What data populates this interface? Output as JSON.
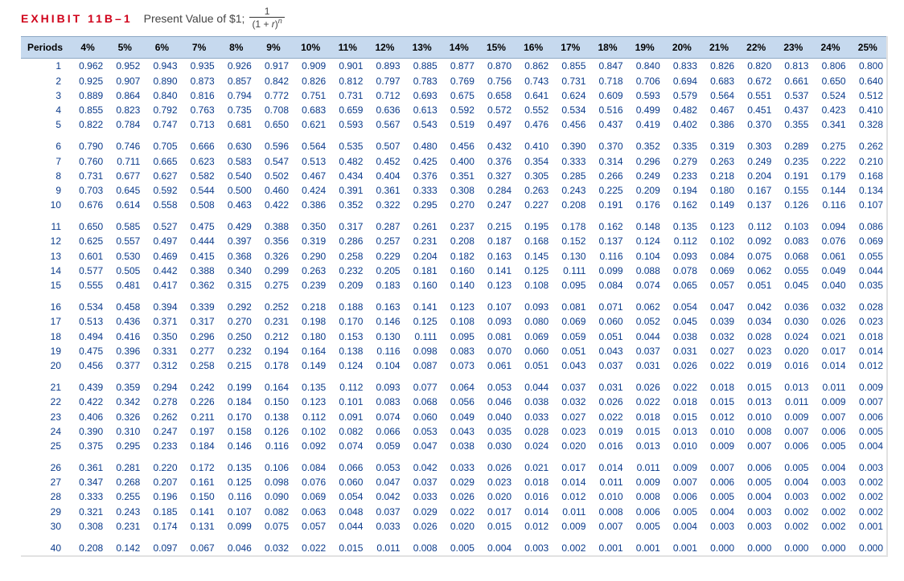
{
  "title": {
    "exhibit": "EXHIBIT 11B–1",
    "text": "Present Value of $1;",
    "frac_num": "1",
    "frac_den_l": "(1 + ",
    "frac_den_var": "r",
    "frac_den_r": ")",
    "frac_exp": "n"
  },
  "headers": [
    "Periods",
    "4%",
    "5%",
    "6%",
    "7%",
    "8%",
    "9%",
    "10%",
    "11%",
    "12%",
    "13%",
    "14%",
    "15%",
    "16%",
    "17%",
    "18%",
    "19%",
    "20%",
    "21%",
    "22%",
    "23%",
    "24%",
    "25%"
  ],
  "groups": [
    [
      {
        "p": 1,
        "v": [
          "0.962",
          "0.952",
          "0.943",
          "0.935",
          "0.926",
          "0.917",
          "0.909",
          "0.901",
          "0.893",
          "0.885",
          "0.877",
          "0.870",
          "0.862",
          "0.855",
          "0.847",
          "0.840",
          "0.833",
          "0.826",
          "0.820",
          "0.813",
          "0.806",
          "0.800"
        ]
      },
      {
        "p": 2,
        "v": [
          "0.925",
          "0.907",
          "0.890",
          "0.873",
          "0.857",
          "0.842",
          "0.826",
          "0.812",
          "0.797",
          "0.783",
          "0.769",
          "0.756",
          "0.743",
          "0.731",
          "0.718",
          "0.706",
          "0.694",
          "0.683",
          "0.672",
          "0.661",
          "0.650",
          "0.640"
        ]
      },
      {
        "p": 3,
        "v": [
          "0.889",
          "0.864",
          "0.840",
          "0.816",
          "0.794",
          "0.772",
          "0.751",
          "0.731",
          "0.712",
          "0.693",
          "0.675",
          "0.658",
          "0.641",
          "0.624",
          "0.609",
          "0.593",
          "0.579",
          "0.564",
          "0.551",
          "0.537",
          "0.524",
          "0.512"
        ]
      },
      {
        "p": 4,
        "v": [
          "0.855",
          "0.823",
          "0.792",
          "0.763",
          "0.735",
          "0.708",
          "0.683",
          "0.659",
          "0.636",
          "0.613",
          "0.592",
          "0.572",
          "0.552",
          "0.534",
          "0.516",
          "0.499",
          "0.482",
          "0.467",
          "0.451",
          "0.437",
          "0.423",
          "0.410"
        ]
      },
      {
        "p": 5,
        "v": [
          "0.822",
          "0.784",
          "0.747",
          "0.713",
          "0.681",
          "0.650",
          "0.621",
          "0.593",
          "0.567",
          "0.543",
          "0.519",
          "0.497",
          "0.476",
          "0.456",
          "0.437",
          "0.419",
          "0.402",
          "0.386",
          "0.370",
          "0.355",
          "0.341",
          "0.328"
        ]
      }
    ],
    [
      {
        "p": 6,
        "v": [
          "0.790",
          "0.746",
          "0.705",
          "0.666",
          "0.630",
          "0.596",
          "0.564",
          "0.535",
          "0.507",
          "0.480",
          "0.456",
          "0.432",
          "0.410",
          "0.390",
          "0.370",
          "0.352",
          "0.335",
          "0.319",
          "0.303",
          "0.289",
          "0.275",
          "0.262"
        ]
      },
      {
        "p": 7,
        "v": [
          "0.760",
          "0.711",
          "0.665",
          "0.623",
          "0.583",
          "0.547",
          "0.513",
          "0.482",
          "0.452",
          "0.425",
          "0.400",
          "0.376",
          "0.354",
          "0.333",
          "0.314",
          "0.296",
          "0.279",
          "0.263",
          "0.249",
          "0.235",
          "0.222",
          "0.210"
        ]
      },
      {
        "p": 8,
        "v": [
          "0.731",
          "0.677",
          "0.627",
          "0.582",
          "0.540",
          "0.502",
          "0.467",
          "0.434",
          "0.404",
          "0.376",
          "0.351",
          "0.327",
          "0.305",
          "0.285",
          "0.266",
          "0.249",
          "0.233",
          "0.218",
          "0.204",
          "0.191",
          "0.179",
          "0.168"
        ]
      },
      {
        "p": 9,
        "v": [
          "0.703",
          "0.645",
          "0.592",
          "0.544",
          "0.500",
          "0.460",
          "0.424",
          "0.391",
          "0.361",
          "0.333",
          "0.308",
          "0.284",
          "0.263",
          "0.243",
          "0.225",
          "0.209",
          "0.194",
          "0.180",
          "0.167",
          "0.155",
          "0.144",
          "0.134"
        ]
      },
      {
        "p": 10,
        "v": [
          "0.676",
          "0.614",
          "0.558",
          "0.508",
          "0.463",
          "0.422",
          "0.386",
          "0.352",
          "0.322",
          "0.295",
          "0.270",
          "0.247",
          "0.227",
          "0.208",
          "0.191",
          "0.176",
          "0.162",
          "0.149",
          "0.137",
          "0.126",
          "0.116",
          "0.107"
        ]
      }
    ],
    [
      {
        "p": 11,
        "v": [
          "0.650",
          "0.585",
          "0.527",
          "0.475",
          "0.429",
          "0.388",
          "0.350",
          "0.317",
          "0.287",
          "0.261",
          "0.237",
          "0.215",
          "0.195",
          "0.178",
          "0.162",
          "0.148",
          "0.135",
          "0.123",
          "0.112",
          "0.103",
          "0.094",
          "0.086"
        ]
      },
      {
        "p": 12,
        "v": [
          "0.625",
          "0.557",
          "0.497",
          "0.444",
          "0.397",
          "0.356",
          "0.319",
          "0.286",
          "0.257",
          "0.231",
          "0.208",
          "0.187",
          "0.168",
          "0.152",
          "0.137",
          "0.124",
          "0.112",
          "0.102",
          "0.092",
          "0.083",
          "0.076",
          "0.069"
        ]
      },
      {
        "p": 13,
        "v": [
          "0.601",
          "0.530",
          "0.469",
          "0.415",
          "0.368",
          "0.326",
          "0.290",
          "0.258",
          "0.229",
          "0.204",
          "0.182",
          "0.163",
          "0.145",
          "0.130",
          "0.116",
          "0.104",
          "0.093",
          "0.084",
          "0.075",
          "0.068",
          "0.061",
          "0.055"
        ]
      },
      {
        "p": 14,
        "v": [
          "0.577",
          "0.505",
          "0.442",
          "0.388",
          "0.340",
          "0.299",
          "0.263",
          "0.232",
          "0.205",
          "0.181",
          "0.160",
          "0.141",
          "0.125",
          "0.111",
          "0.099",
          "0.088",
          "0.078",
          "0.069",
          "0.062",
          "0.055",
          "0.049",
          "0.044"
        ]
      },
      {
        "p": 15,
        "v": [
          "0.555",
          "0.481",
          "0.417",
          "0.362",
          "0.315",
          "0.275",
          "0.239",
          "0.209",
          "0.183",
          "0.160",
          "0.140",
          "0.123",
          "0.108",
          "0.095",
          "0.084",
          "0.074",
          "0.065",
          "0.057",
          "0.051",
          "0.045",
          "0.040",
          "0.035"
        ]
      }
    ],
    [
      {
        "p": 16,
        "v": [
          "0.534",
          "0.458",
          "0.394",
          "0.339",
          "0.292",
          "0.252",
          "0.218",
          "0.188",
          "0.163",
          "0.141",
          "0.123",
          "0.107",
          "0.093",
          "0.081",
          "0.071",
          "0.062",
          "0.054",
          "0.047",
          "0.042",
          "0.036",
          "0.032",
          "0.028"
        ]
      },
      {
        "p": 17,
        "v": [
          "0.513",
          "0.436",
          "0.371",
          "0.317",
          "0.270",
          "0.231",
          "0.198",
          "0.170",
          "0.146",
          "0.125",
          "0.108",
          "0.093",
          "0.080",
          "0.069",
          "0.060",
          "0.052",
          "0.045",
          "0.039",
          "0.034",
          "0.030",
          "0.026",
          "0.023"
        ]
      },
      {
        "p": 18,
        "v": [
          "0.494",
          "0.416",
          "0.350",
          "0.296",
          "0.250",
          "0.212",
          "0.180",
          "0.153",
          "0.130",
          "0.111",
          "0.095",
          "0.081",
          "0.069",
          "0.059",
          "0.051",
          "0.044",
          "0.038",
          "0.032",
          "0.028",
          "0.024",
          "0.021",
          "0.018"
        ]
      },
      {
        "p": 19,
        "v": [
          "0.475",
          "0.396",
          "0.331",
          "0.277",
          "0.232",
          "0.194",
          "0.164",
          "0.138",
          "0.116",
          "0.098",
          "0.083",
          "0.070",
          "0.060",
          "0.051",
          "0.043",
          "0.037",
          "0.031",
          "0.027",
          "0.023",
          "0.020",
          "0.017",
          "0.014"
        ]
      },
      {
        "p": 20,
        "v": [
          "0.456",
          "0.377",
          "0.312",
          "0.258",
          "0.215",
          "0.178",
          "0.149",
          "0.124",
          "0.104",
          "0.087",
          "0.073",
          "0.061",
          "0.051",
          "0.043",
          "0.037",
          "0.031",
          "0.026",
          "0.022",
          "0.019",
          "0.016",
          "0.014",
          "0.012"
        ]
      }
    ],
    [
      {
        "p": 21,
        "v": [
          "0.439",
          "0.359",
          "0.294",
          "0.242",
          "0.199",
          "0.164",
          "0.135",
          "0.112",
          "0.093",
          "0.077",
          "0.064",
          "0.053",
          "0.044",
          "0.037",
          "0.031",
          "0.026",
          "0.022",
          "0.018",
          "0.015",
          "0.013",
          "0.011",
          "0.009"
        ]
      },
      {
        "p": 22,
        "v": [
          "0.422",
          "0.342",
          "0.278",
          "0.226",
          "0.184",
          "0.150",
          "0.123",
          "0.101",
          "0.083",
          "0.068",
          "0.056",
          "0.046",
          "0.038",
          "0.032",
          "0.026",
          "0.022",
          "0.018",
          "0.015",
          "0.013",
          "0.011",
          "0.009",
          "0.007"
        ]
      },
      {
        "p": 23,
        "v": [
          "0.406",
          "0.326",
          "0.262",
          "0.211",
          "0.170",
          "0.138",
          "0.112",
          "0.091",
          "0.074",
          "0.060",
          "0.049",
          "0.040",
          "0.033",
          "0.027",
          "0.022",
          "0.018",
          "0.015",
          "0.012",
          "0.010",
          "0.009",
          "0.007",
          "0.006"
        ]
      },
      {
        "p": 24,
        "v": [
          "0.390",
          "0.310",
          "0.247",
          "0.197",
          "0.158",
          "0.126",
          "0.102",
          "0.082",
          "0.066",
          "0.053",
          "0.043",
          "0.035",
          "0.028",
          "0.023",
          "0.019",
          "0.015",
          "0.013",
          "0.010",
          "0.008",
          "0.007",
          "0.006",
          "0.005"
        ]
      },
      {
        "p": 25,
        "v": [
          "0.375",
          "0.295",
          "0.233",
          "0.184",
          "0.146",
          "0.116",
          "0.092",
          "0.074",
          "0.059",
          "0.047",
          "0.038",
          "0.030",
          "0.024",
          "0.020",
          "0.016",
          "0.013",
          "0.010",
          "0.009",
          "0.007",
          "0.006",
          "0.005",
          "0.004"
        ]
      }
    ],
    [
      {
        "p": 26,
        "v": [
          "0.361",
          "0.281",
          "0.220",
          "0.172",
          "0.135",
          "0.106",
          "0.084",
          "0.066",
          "0.053",
          "0.042",
          "0.033",
          "0.026",
          "0.021",
          "0.017",
          "0.014",
          "0.011",
          "0.009",
          "0.007",
          "0.006",
          "0.005",
          "0.004",
          "0.003"
        ]
      },
      {
        "p": 27,
        "v": [
          "0.347",
          "0.268",
          "0.207",
          "0.161",
          "0.125",
          "0.098",
          "0.076",
          "0.060",
          "0.047",
          "0.037",
          "0.029",
          "0.023",
          "0.018",
          "0.014",
          "0.011",
          "0.009",
          "0.007",
          "0.006",
          "0.005",
          "0.004",
          "0.003",
          "0.002"
        ]
      },
      {
        "p": 28,
        "v": [
          "0.333",
          "0.255",
          "0.196",
          "0.150",
          "0.116",
          "0.090",
          "0.069",
          "0.054",
          "0.042",
          "0.033",
          "0.026",
          "0.020",
          "0.016",
          "0.012",
          "0.010",
          "0.008",
          "0.006",
          "0.005",
          "0.004",
          "0.003",
          "0.002",
          "0.002"
        ]
      },
      {
        "p": 29,
        "v": [
          "0.321",
          "0.243",
          "0.185",
          "0.141",
          "0.107",
          "0.082",
          "0.063",
          "0.048",
          "0.037",
          "0.029",
          "0.022",
          "0.017",
          "0.014",
          "0.011",
          "0.008",
          "0.006",
          "0.005",
          "0.004",
          "0.003",
          "0.002",
          "0.002",
          "0.002"
        ]
      },
      {
        "p": 30,
        "v": [
          "0.308",
          "0.231",
          "0.174",
          "0.131",
          "0.099",
          "0.075",
          "0.057",
          "0.044",
          "0.033",
          "0.026",
          "0.020",
          "0.015",
          "0.012",
          "0.009",
          "0.007",
          "0.005",
          "0.004",
          "0.003",
          "0.003",
          "0.002",
          "0.002",
          "0.001"
        ]
      }
    ],
    [
      {
        "p": 40,
        "v": [
          "0.208",
          "0.142",
          "0.097",
          "0.067",
          "0.046",
          "0.032",
          "0.022",
          "0.015",
          "0.011",
          "0.008",
          "0.005",
          "0.004",
          "0.003",
          "0.002",
          "0.001",
          "0.001",
          "0.001",
          "0.000",
          "0.000",
          "0.000",
          "0.000",
          "0.000"
        ]
      }
    ]
  ]
}
